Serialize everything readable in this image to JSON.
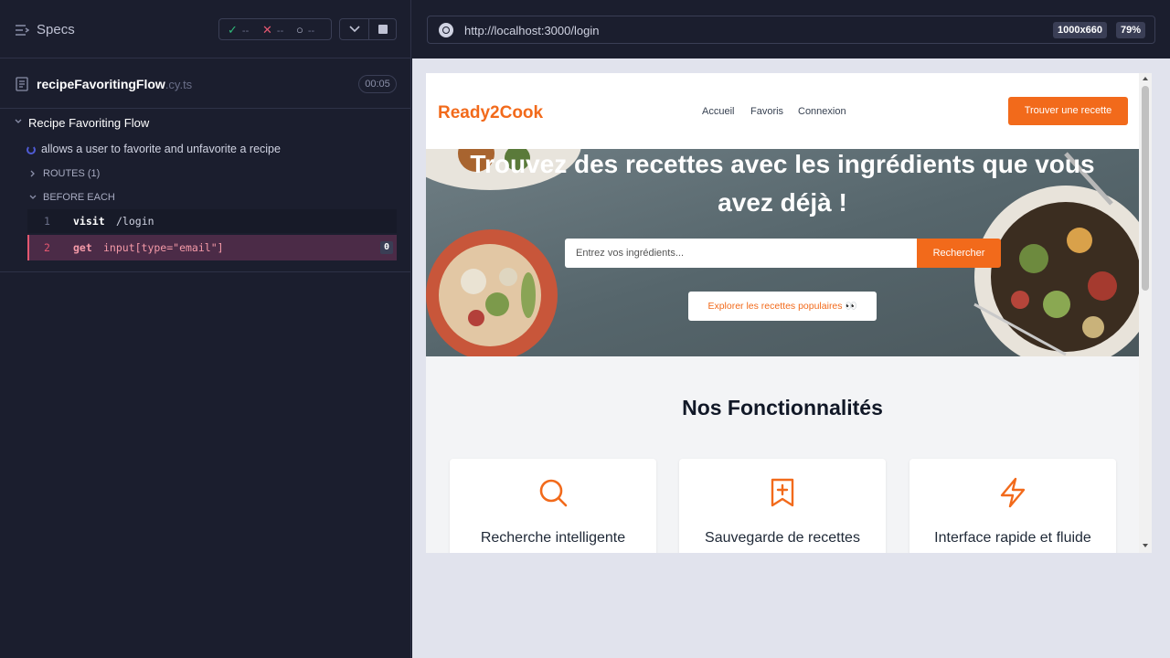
{
  "specs": {
    "title": "Specs",
    "stats": {
      "passed": "--",
      "failed": "--",
      "pending": "--"
    }
  },
  "file": {
    "name": "recipeFavoritingFlow",
    "ext": ".cy.ts",
    "duration": "00:05"
  },
  "suite": {
    "title": "Recipe Favoriting Flow",
    "test_title": "allows a user to favorite and unfavorite a recipe",
    "routes_label": "ROUTES (1)",
    "before_each_label": "BEFORE EACH",
    "commands": [
      {
        "num": "1",
        "name": "visit",
        "arg": "/login"
      },
      {
        "num": "2",
        "name": "get",
        "arg": "input[type=\"email\"]",
        "badge": "0"
      }
    ]
  },
  "browser": {
    "url": "http://localhost:3000/login",
    "viewport": "1000x660",
    "zoom": "79%"
  },
  "app": {
    "logo": "Ready2Cook",
    "nav": [
      "Accueil",
      "Favoris",
      "Connexion"
    ],
    "cta": "Trouver une recette",
    "hero_title": "Trouvez des recettes avec les ingrédients que vous avez déjà !",
    "search_placeholder": "Entrez vos ingrédients...",
    "search_button": "Rechercher",
    "explore_button": "Explorer les recettes populaires 👀",
    "features_title": "Nos Fonctionnalités",
    "features": [
      {
        "icon": "search-icon",
        "title": "Recherche intelligente"
      },
      {
        "icon": "bookmark-plus-icon",
        "title": "Sauvegarde de recettes"
      },
      {
        "icon": "lightning-icon",
        "title": "Interface rapide et fluide"
      }
    ],
    "accent_color": "#f26a1b"
  }
}
